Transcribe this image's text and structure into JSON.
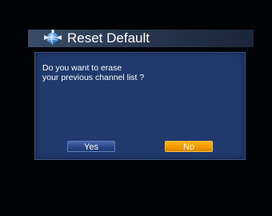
{
  "header": {
    "title": "Reset Default",
    "icon": "globe-satellite-icon"
  },
  "dialog": {
    "message_lines": [
      "Do you want to erase",
      "your previous channel list ?"
    ],
    "buttons": {
      "yes_label": "Yes",
      "no_label": "No",
      "focused": "No"
    }
  },
  "colors": {
    "background": "#020306",
    "titlebar": "#2a3a52",
    "dialog_bg": "#203a6e",
    "button_normal": "#2a488a",
    "button_focused": "#f29a00",
    "text": "#ffffff"
  }
}
